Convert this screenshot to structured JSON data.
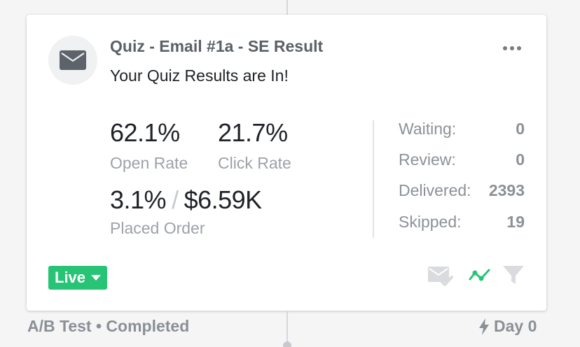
{
  "card": {
    "title": "Quiz - Email #1a - SE Result",
    "subject": "Your Quiz Results are In!",
    "icon": "envelope-icon",
    "menu_icon": "more-horizontal-icon"
  },
  "stats": {
    "open_rate": {
      "value": "62.1%",
      "label": "Open Rate"
    },
    "click_rate": {
      "value": "21.7%",
      "label": "Click Rate"
    },
    "placed_order": {
      "value": "3.1%",
      "separator": "/",
      "revenue": "$6.59K",
      "label": "Placed Order"
    }
  },
  "counts": [
    {
      "label": "Waiting:",
      "value": "0"
    },
    {
      "label": "Review:",
      "value": "0"
    },
    {
      "label": "Delivered:",
      "value": "2393"
    },
    {
      "label": "Skipped:",
      "value": "19"
    }
  ],
  "status": {
    "label": "Live",
    "color": "#27c475"
  },
  "actions": [
    "email-check-icon",
    "trend-icon",
    "filter-icon"
  ],
  "footer": {
    "left": "A/B Test • Completed",
    "right": "Day 0",
    "right_icon": "lightning-icon"
  },
  "colors": {
    "accent_green": "#27c475",
    "title_gray": "#5b6066",
    "label_gray": "#9da2a8"
  }
}
